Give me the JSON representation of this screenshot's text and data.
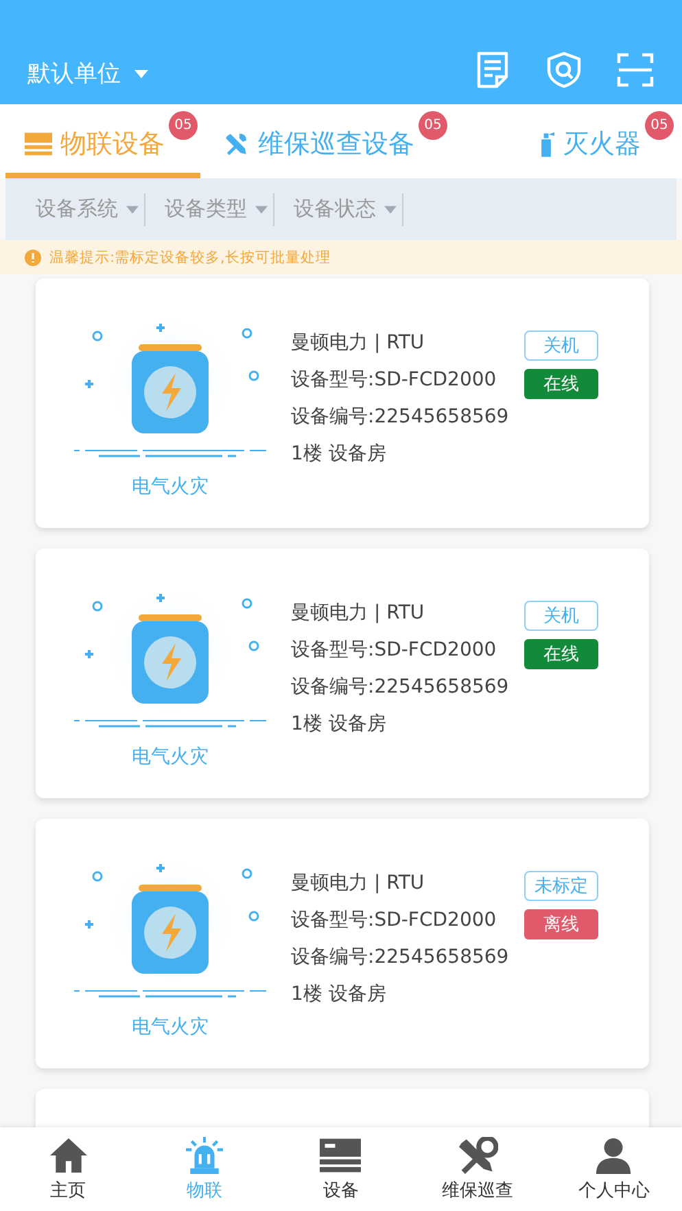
{
  "header": {
    "title": "默认单位"
  },
  "tabs": [
    {
      "label": "物联设备",
      "badge": "05",
      "selected": true
    },
    {
      "label": "维保巡查设备",
      "badge": "05",
      "selected": false
    },
    {
      "label": "灭火器",
      "badge": "05",
      "selected": false
    }
  ],
  "filters": [
    "设备系统",
    "设备类型",
    "设备状态"
  ],
  "tip": "温馨提示:需标定设备较多,长按可批量处理",
  "devices": [
    {
      "category": "电气火灾",
      "brand": "曼顿电力 | RTU",
      "model": "设备型号:SD-FCD2000",
      "serial": "设备编号:22545658569",
      "location": "1楼 设备房",
      "tag": "关机",
      "status": "在线",
      "online": true
    },
    {
      "category": "电气火灾",
      "brand": "曼顿电力 | RTU",
      "model": "设备型号:SD-FCD2000",
      "serial": "设备编号:22545658569",
      "location": "1楼 设备房",
      "tag": "关机",
      "status": "在线",
      "online": true
    },
    {
      "category": "电气火灾",
      "brand": "曼顿电力 | RTU",
      "model": "设备型号:SD-FCD2000",
      "serial": "设备编号:22545658569",
      "location": "1楼 设备房",
      "tag": "未标定",
      "status": "离线",
      "online": false
    }
  ],
  "nav": [
    {
      "label": "主页",
      "selected": false
    },
    {
      "label": "物联",
      "selected": true
    },
    {
      "label": "设备",
      "selected": false
    },
    {
      "label": "维保巡查",
      "selected": false
    },
    {
      "label": "个人中心",
      "selected": false
    }
  ]
}
